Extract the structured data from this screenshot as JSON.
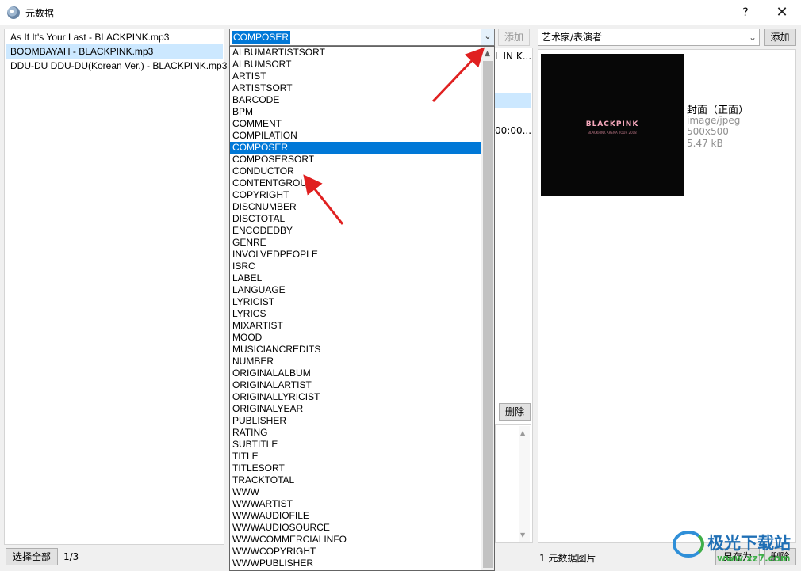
{
  "window": {
    "title": "元数据",
    "help": "?",
    "close": "✕"
  },
  "files": [
    "As If It's Your Last - BLACKPINK.mp3",
    "BOOMBAYAH - BLACKPINK.mp3",
    "DDU-DU DDU-DU(Korean Ver.) - BLACKPINK.mp3"
  ],
  "selected_file_index": 1,
  "bottom": {
    "select_all": "选择全部",
    "count": "1/3"
  },
  "field_combo": {
    "value": "COMPOSER",
    "add": "添加"
  },
  "field_options": [
    "ALBUMARTISTSORT",
    "ALBUMSORT",
    "ARTIST",
    "ARTISTSORT",
    "BARCODE",
    "BPM",
    "COMMENT",
    "COMPILATION",
    "COMPOSER",
    "COMPOSERSORT",
    "CONDUCTOR",
    "CONTENTGROUP",
    "COPYRIGHT",
    "DISCNUMBER",
    "DISCTOTAL",
    "ENCODEDBY",
    "GENRE",
    "INVOLVEDPEOPLE",
    "ISRC",
    "LABEL",
    "LANGUAGE",
    "LYRICIST",
    "LYRICS",
    "MIXARTIST",
    "MOOD",
    "MUSICIANCREDITS",
    "NUMBER",
    "ORIGINALALBUM",
    "ORIGINALARTIST",
    "ORIGINALLYRICIST",
    "ORIGINALYEAR",
    "PUBLISHER",
    "RATING",
    "SUBTITLE",
    "TITLE",
    "TITLESORT",
    "TRACKTOTAL",
    "WWW",
    "WWWARTIST",
    "WWWAUDIOFILE",
    "WWWAUDIOSOURCE",
    "WWWCOMMERCIALINFO",
    "WWWCOPYRIGHT",
    "WWWPUBLISHER"
  ],
  "selected_option_index": 8,
  "middle": {
    "text1": "L IN K...",
    "text2": "00:00....",
    "delete": "删除"
  },
  "picture": {
    "role": "艺术家/表演者",
    "add": "添加",
    "cover_brand": "BLACKPINK",
    "cover_subtext": "BLACKPINK ARENA TOUR 2018",
    "type": "封面（正面）",
    "mime": "image/jpeg",
    "dimensions": "500x500",
    "size": "5.47 kB",
    "count": "1 元数据图片",
    "save_as": "另存为",
    "delete": "删除"
  },
  "watermark": {
    "text": "极光下载站",
    "url": "www.xz7.com"
  },
  "colors": {
    "selection": "#0078d7",
    "list_highlight": "#cce8ff",
    "arrow": "#e02020"
  }
}
